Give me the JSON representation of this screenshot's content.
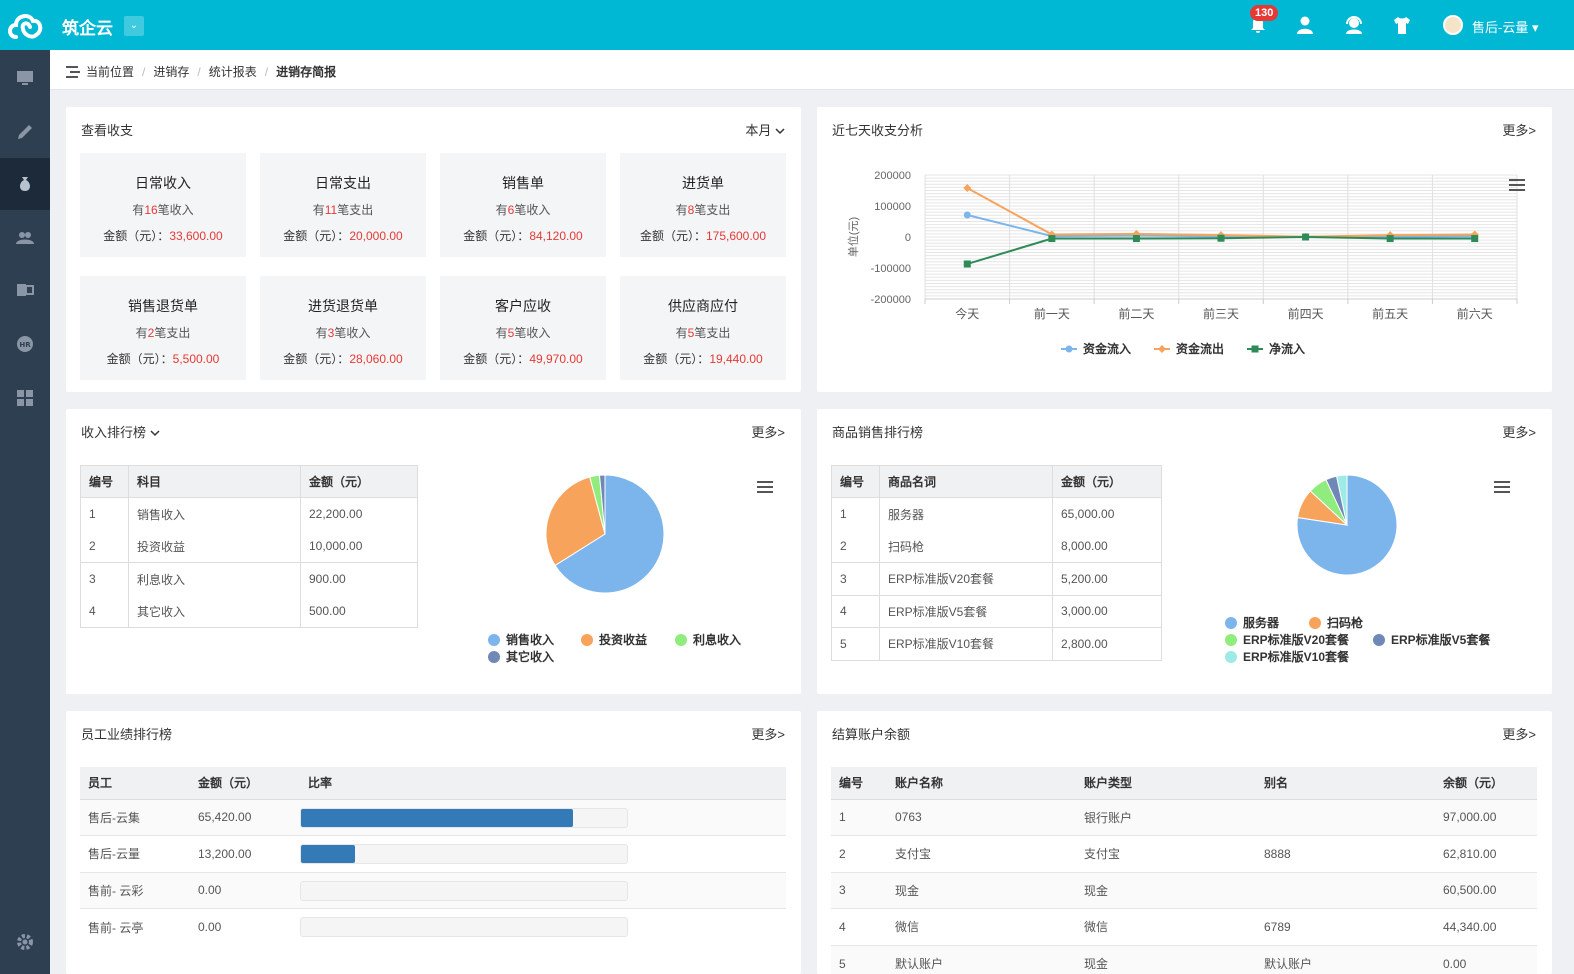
{
  "app": {
    "brand": "筑企云",
    "brand_dropdown": "⌄",
    "notification_count": "130",
    "user": "售后-云量 ▾"
  },
  "breadcrumb": {
    "label": "当前位置",
    "items": [
      "进销存",
      "统计报表",
      "进销存简报"
    ]
  },
  "income_panel": {
    "title": "查看收支",
    "period": "本月",
    "cards": [
      {
        "title": "日常收入",
        "pre": "有",
        "count": "16",
        "post": "笔收入",
        "amount_label": "金额（元）：",
        "amount": "33,600.00"
      },
      {
        "title": "日常支出",
        "pre": "有",
        "count": "11",
        "post": "笔支出",
        "amount_label": "金额（元）：",
        "amount": "20,000.00"
      },
      {
        "title": "销售单",
        "pre": "有",
        "count": "6",
        "post": "笔收入",
        "amount_label": "金额（元）：",
        "amount": "84,120.00"
      },
      {
        "title": "进货单",
        "pre": "有",
        "count": "8",
        "post": "笔支出",
        "amount_label": "金额（元）：",
        "amount": "175,600.00"
      },
      {
        "title": "销售退货单",
        "pre": "有",
        "count": "2",
        "post": "笔支出",
        "amount_label": "金额（元）：",
        "amount": "5,500.00"
      },
      {
        "title": "进货退货单",
        "pre": "有",
        "count": "3",
        "post": "笔收入",
        "amount_label": "金额（元）：",
        "amount": "28,060.00"
      },
      {
        "title": "客户应收",
        "pre": "有",
        "count": "5",
        "post": "笔收入",
        "amount_label": "金额（元）：",
        "amount": "49,970.00"
      },
      {
        "title": "供应商应付",
        "pre": "有",
        "count": "5",
        "post": "笔支出",
        "amount_label": "金额（元）：",
        "amount": "19,440.00"
      }
    ]
  },
  "seven_day": {
    "title": "近七天收支分析",
    "more": "更多>"
  },
  "ranking": {
    "title": "收入排行榜",
    "more": "更多>",
    "headers": [
      "编号",
      "科目",
      "金额（元）"
    ],
    "rows": [
      [
        "1",
        "销售收入",
        "22,200.00"
      ],
      [
        "2",
        "投资收益",
        "10,000.00"
      ],
      [
        "3",
        "利息收入",
        "900.00"
      ],
      [
        "4",
        "其它收入",
        "500.00"
      ]
    ]
  },
  "goods": {
    "title": "商品销售排行榜",
    "more": "更多>",
    "headers": [
      "编号",
      "商品名词",
      "金额（元）"
    ],
    "rows": [
      [
        "1",
        "服务器",
        "65,000.00"
      ],
      [
        "2",
        "扫码枪",
        "8,000.00"
      ],
      [
        "3",
        "ERP标准版V20套餐",
        "5,200.00"
      ],
      [
        "4",
        "ERP标准版V5套餐",
        "3,000.00"
      ],
      [
        "5",
        "ERP标准版V10套餐",
        "2,800.00"
      ]
    ]
  },
  "staff": {
    "title": "员工业绩排行榜",
    "more": "更多>",
    "headers": [
      "员工",
      "金额（元）",
      "比率"
    ],
    "rows": [
      {
        "name": "售后-云集",
        "amount": "65,420.00",
        "ratio": 0.835
      },
      {
        "name": "售后-云量",
        "amount": "13,200.00",
        "ratio": 0.165
      },
      {
        "name": "售前- 云彩",
        "amount": "0.00",
        "ratio": 0
      },
      {
        "name": "售前- 云亭",
        "amount": "0.00",
        "ratio": 0
      }
    ]
  },
  "accounts": {
    "title": "结算账户余额",
    "more": "更多>",
    "headers": [
      "编号",
      "账户名称",
      "账户类型",
      "别名",
      "余额（元）"
    ],
    "rows": [
      [
        "1",
        "0763",
        "银行账户",
        "",
        "97,000.00"
      ],
      [
        "2",
        "支付宝",
        "支付宝",
        "8888",
        "62,810.00"
      ],
      [
        "3",
        "现金",
        "现金",
        "",
        "60,500.00"
      ],
      [
        "4",
        "微信",
        "微信",
        "6789",
        "44,340.00"
      ],
      [
        "5",
        "默认账户",
        "现金",
        "默认账户",
        "0.00"
      ]
    ]
  },
  "chart_data": [
    {
      "type": "line",
      "ylabel": "单位(元)",
      "categories": [
        "今天",
        "前一天",
        "前二天",
        "前三天",
        "前四天",
        "前五天",
        "前六天"
      ],
      "ylim": [
        -200000,
        200000
      ],
      "yticks": [
        "200000",
        "100000",
        "0",
        "-100000",
        "-200000"
      ],
      "series": [
        {
          "name": "资金流入",
          "color": "#7cb5ec",
          "values": [
            71000,
            3000,
            5000,
            2000,
            1000,
            1000,
            3000
          ]
        },
        {
          "name": "资金流出",
          "color": "#f7a35c",
          "values": [
            158000,
            8000,
            10000,
            6000,
            1000,
            6000,
            8000
          ]
        },
        {
          "name": "净流入",
          "color": "#2e8b57",
          "values": [
            -87000,
            -5000,
            -5000,
            -4000,
            0,
            -5000,
            -5000
          ]
        }
      ],
      "legend": "bottom"
    },
    {
      "type": "pie",
      "categories": [
        "销售收入",
        "投资收益",
        "利息收入",
        "其它收入"
      ],
      "values": [
        22200,
        10000,
        900,
        500
      ],
      "colors": [
        "#7cb5ec",
        "#f7a35c",
        "#90ed7d",
        "#6f88b5"
      ]
    },
    {
      "type": "pie",
      "categories": [
        "服务器",
        "扫码枪",
        "ERP标准版V20套餐",
        "ERP标准版V5套餐",
        "ERP标准版V10套餐"
      ],
      "values": [
        65000,
        8000,
        5200,
        3000,
        2800
      ],
      "colors": [
        "#7cb5ec",
        "#f7a35c",
        "#90ed7d",
        "#6f88b5",
        "#9eeae6"
      ]
    }
  ]
}
